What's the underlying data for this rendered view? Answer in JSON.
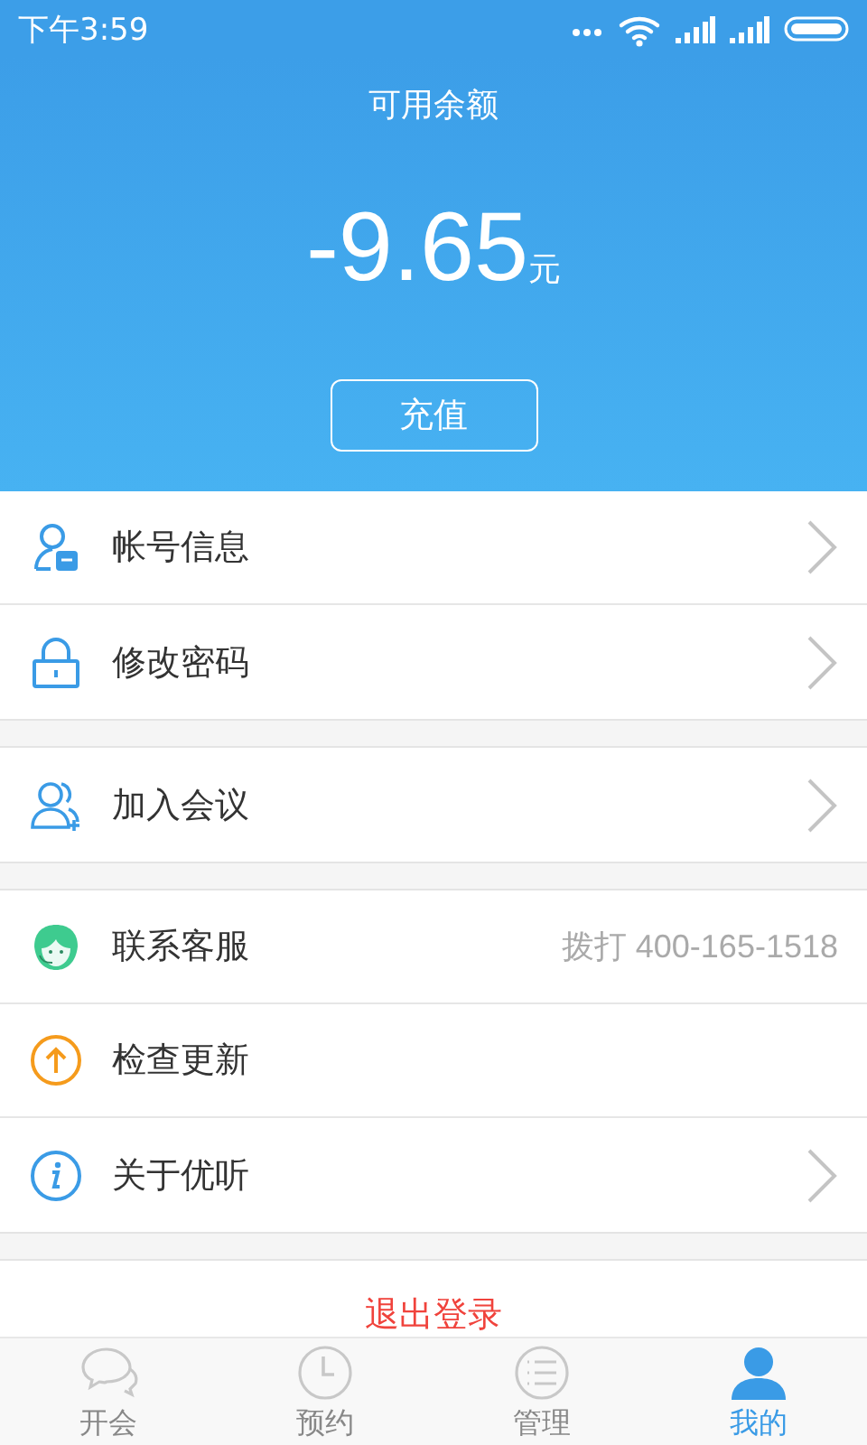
{
  "status_bar": {
    "time": "下午3:59"
  },
  "balance": {
    "label": "可用余额",
    "amount": "-9.65",
    "unit": "元",
    "button": "充值"
  },
  "menu_groups": [
    {
      "items": [
        {
          "label": "帐号信息",
          "kind": "link"
        },
        {
          "label": "修改密码",
          "kind": "link"
        }
      ]
    },
    {
      "items": [
        {
          "label": "加入会议",
          "kind": "link"
        }
      ]
    },
    {
      "items": [
        {
          "label": "联系客服",
          "kind": "detail",
          "detail": "拨打 400-165-1518"
        },
        {
          "label": "检查更新",
          "kind": "plain"
        },
        {
          "label": "关于优听",
          "kind": "link"
        }
      ]
    }
  ],
  "logout": {
    "label": "退出登录"
  },
  "tabs": [
    {
      "label": "开会",
      "selected": false
    },
    {
      "label": "预约",
      "selected": false
    },
    {
      "label": "管理",
      "selected": false
    },
    {
      "label": "我的",
      "selected": true
    }
  ]
}
